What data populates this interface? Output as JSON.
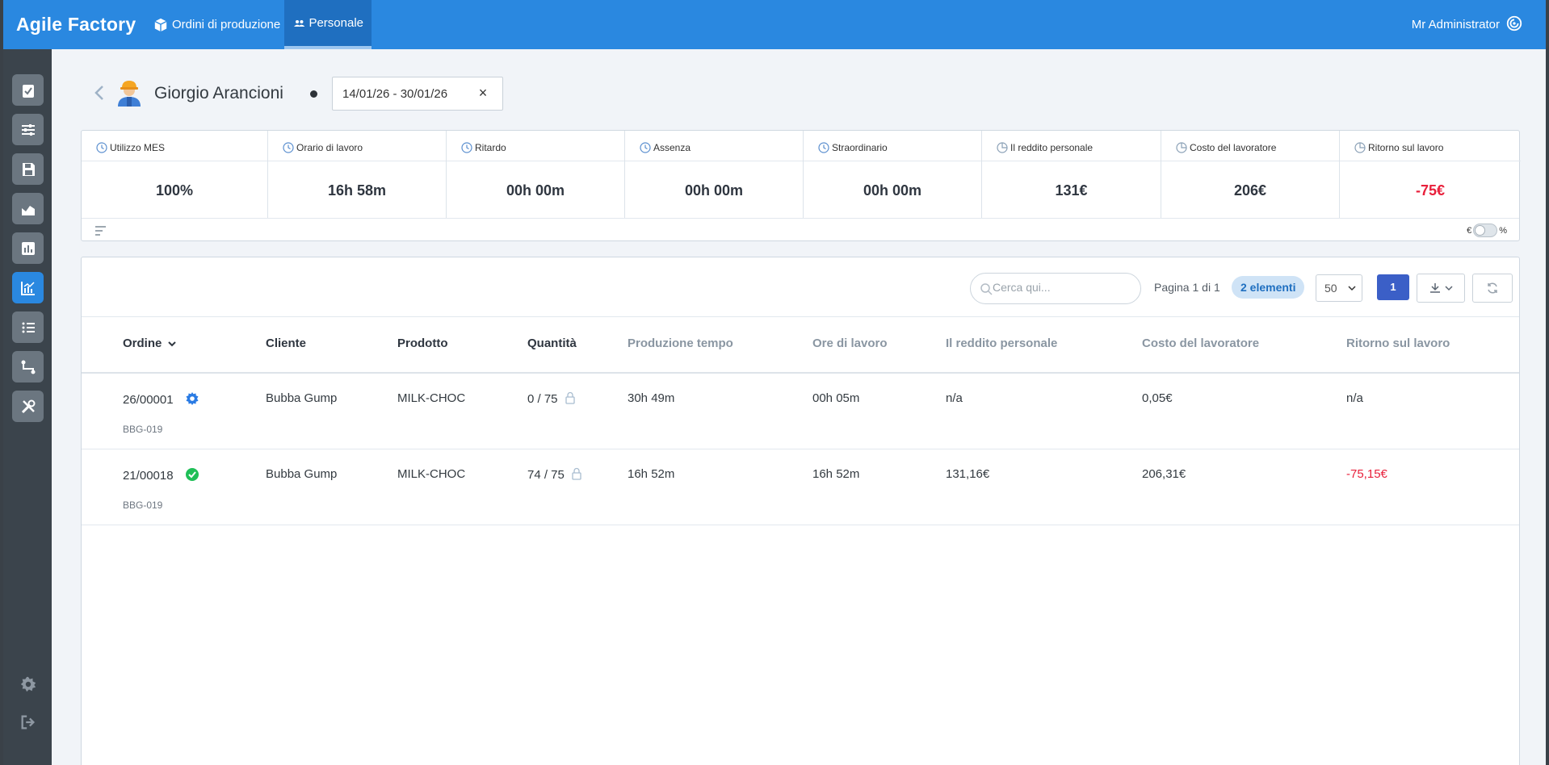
{
  "header": {
    "brand": "Agile Factory",
    "nav": [
      {
        "label": "Ordini di produzione",
        "icon": "box-icon"
      },
      {
        "label": "Personale",
        "icon": "users-icon"
      }
    ],
    "user": "Mr Administrator"
  },
  "sidebar": {
    "items": [
      "clipboard-check-icon",
      "sliders-icon",
      "save-icon",
      "area-chart-icon",
      "bar-chart-icon",
      "line-chart-icon",
      "list-icon",
      "route-icon",
      "tools-icon"
    ],
    "active": "line-chart-icon",
    "bottom": [
      "gear-icon",
      "logout-icon"
    ]
  },
  "person": {
    "name": "Giorgio Arancioni",
    "date_range": "14/01/26 - 30/01/26",
    "clear": "×"
  },
  "kpis": [
    {
      "label": "Utilizzo MES",
      "value": "100%",
      "icon": "clock-icon"
    },
    {
      "label": "Orario di lavoro",
      "value": "16h 58m",
      "icon": "clock-icon"
    },
    {
      "label": "Ritardo",
      "value": "00h 00m",
      "icon": "clock-icon"
    },
    {
      "label": "Assenza",
      "value": "00h 00m",
      "icon": "clock-icon"
    },
    {
      "label": "Straordinario",
      "value": "00h 00m",
      "icon": "clock-icon"
    },
    {
      "label": "Il reddito personale",
      "value": "131€",
      "icon": "pie-icon"
    },
    {
      "label": "Costo del lavoratore",
      "value": "206€",
      "icon": "pie-icon"
    },
    {
      "label": "Ritorno sul lavoro",
      "value": "-75€",
      "icon": "pie-icon",
      "negative": true
    }
  ],
  "kpi_toggle": {
    "left": "€",
    "right": "%"
  },
  "table": {
    "search_placeholder": "Cerca qui...",
    "page_info": "Pagina 1 di 1",
    "count": "2 elementi",
    "per_page": "50",
    "current_page": "1",
    "columns": [
      "Ordine",
      "Cliente",
      "Prodotto",
      "Quantità",
      "Produzione tempo",
      "Ore di lavoro",
      "Il reddito personale",
      "Costo del lavoratore",
      "Ritorno sul lavoro"
    ],
    "rows": [
      {
        "order": "26/00001",
        "status": "in-progress",
        "code": "BBG-019",
        "client": "Bubba Gump",
        "product": "MILK-CHOC",
        "qty": "0 / 75",
        "prod_time": "30h 49m",
        "work_hours": "00h 05m",
        "income": "n/a",
        "cost": "0,05€",
        "return": "n/a",
        "return_negative": false
      },
      {
        "order": "21/00018",
        "status": "completed",
        "code": "BBG-019",
        "client": "Bubba Gump",
        "product": "MILK-CHOC",
        "qty": "74 / 75",
        "prod_time": "16h 52m",
        "work_hours": "16h 52m",
        "income": "131,16€",
        "cost": "206,31€",
        "return": "-75,15€",
        "return_negative": true
      }
    ]
  },
  "colors": {
    "accent": "#2a88e0",
    "negative": "#e8203b",
    "success": "#1fbf57",
    "sidebar": "#3b444c"
  }
}
